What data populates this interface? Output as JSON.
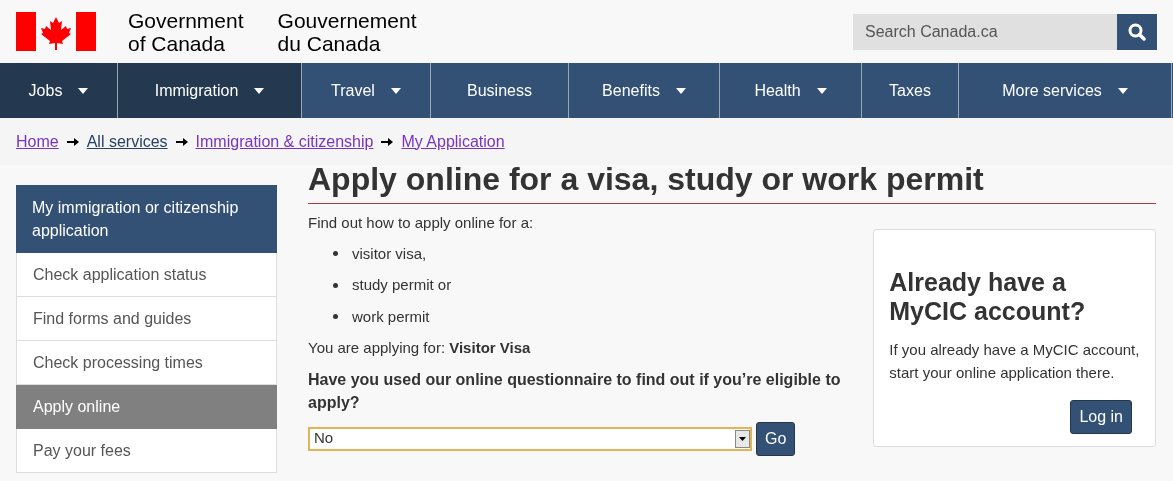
{
  "header": {
    "name_en": [
      "Government",
      "of Canada"
    ],
    "name_fr": [
      "Gouvernement",
      "du Canada"
    ],
    "search": {
      "placeholder": "Search Canada.ca"
    }
  },
  "menu": [
    {
      "label": "Jobs",
      "dropdown": true,
      "active": true
    },
    {
      "label": "Immigration",
      "dropdown": true,
      "active": true
    },
    {
      "label": "Travel",
      "dropdown": true,
      "active": false
    },
    {
      "label": "Business",
      "dropdown": false,
      "active": false
    },
    {
      "label": "Benefits",
      "dropdown": true,
      "active": false
    },
    {
      "label": "Health",
      "dropdown": true,
      "active": false
    },
    {
      "label": "Taxes",
      "dropdown": false,
      "active": false
    },
    {
      "label": "More services",
      "dropdown": true,
      "active": false
    }
  ],
  "breadcrumb": [
    {
      "label": "Home",
      "visited": true
    },
    {
      "label": "All services",
      "visited": false
    },
    {
      "label": "Immigration & citizenship",
      "visited": true
    },
    {
      "label": "My Application",
      "visited": true
    }
  ],
  "sidebar": {
    "title": "My immigration or citizenship application",
    "items": [
      {
        "label": "Check application status",
        "selected": false
      },
      {
        "label": "Find forms and guides",
        "selected": false
      },
      {
        "label": "Check processing times",
        "selected": false
      },
      {
        "label": "Apply online",
        "selected": true
      },
      {
        "label": "Pay your fees",
        "selected": false
      }
    ]
  },
  "main": {
    "title": "Apply online for a visa, study or work permit",
    "intro": "Find out how to apply online for a:",
    "list": [
      "visitor visa,",
      "study permit or",
      "work permit"
    ],
    "applying": "You are applying for: **Visitor Visa**",
    "question": "Have you used our online questionnaire to find out if you’re eligible to apply?",
    "select_value": "No",
    "go_button": "Go"
  },
  "panel": {
    "title": "Already have a MyCIC account?",
    "text": "If you already have a MyCIC account, start your online application there.",
    "button": "Log in"
  }
}
